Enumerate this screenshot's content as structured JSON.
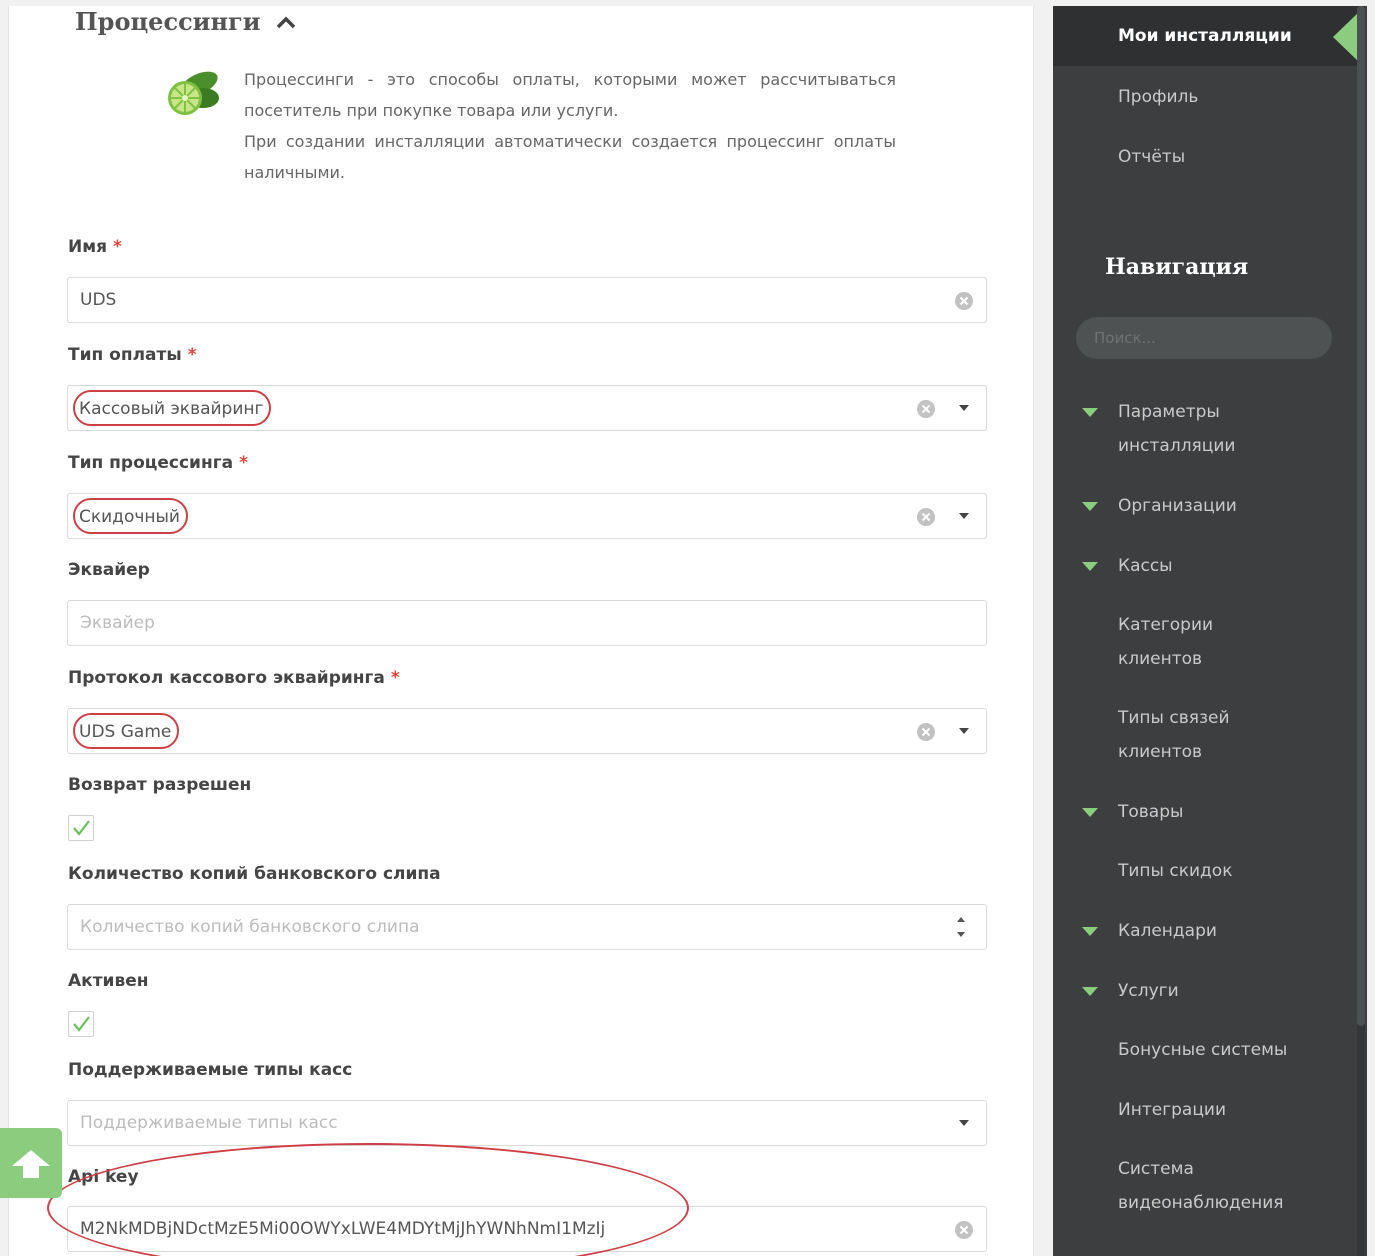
{
  "section": {
    "title": "Процессинги"
  },
  "intro": {
    "line1": "Процессинги - это способы оплаты, которыми может рассчитываться посетитель при покупке товара или услуги.",
    "line2": "При создании инсталляции автоматически создается процессинг оплаты наличными."
  },
  "form": {
    "name": {
      "label": "Имя",
      "required": "*",
      "value": "UDS"
    },
    "payment_type": {
      "label": "Тип оплаты",
      "required": "*",
      "value": "Кассовый эквайринг"
    },
    "processing_type": {
      "label": "Тип процессинга",
      "required": "*",
      "value": "Скидочный"
    },
    "acquirer": {
      "label": "Эквайер",
      "placeholder": "Эквайер"
    },
    "protocol": {
      "label": "Протокол кассового эквайринга",
      "required": "*",
      "value": "UDS Game"
    },
    "refund": {
      "label": "Возврат разрешен",
      "checked": true
    },
    "slip_copies": {
      "label": "Количество копий банковского слипа",
      "placeholder": "Количество копий банковского слипа"
    },
    "active": {
      "label": "Активен",
      "checked": true
    },
    "register_types": {
      "label": "Поддерживаемые типы касс",
      "placeholder": "Поддерживаемые типы касс"
    },
    "api_key": {
      "label": "Api key",
      "value": "M2NkMDBjNDctMzE5Mi00OWYxLWE4MDYtMjJhYWNhNmI1MzIj"
    }
  },
  "sidebar": {
    "top_items": [
      "Мои инсталляции",
      "Профиль",
      "Отчёты"
    ],
    "nav_title": "Навигация",
    "search_placeholder": "Поиск...",
    "nav_items": [
      {
        "label_1": "Параметры",
        "label_2": "инсталляции",
        "expandable": true
      },
      {
        "label_1": "Организации",
        "expandable": true
      },
      {
        "label_1": "Кассы",
        "expandable": true
      },
      {
        "label_1": "Категории",
        "label_2": "клиентов",
        "expandable": false
      },
      {
        "label_1": "Типы связей",
        "label_2": "клиентов",
        "expandable": false
      },
      {
        "label_1": "Товары",
        "expandable": true
      },
      {
        "label_1": "Типы скидок",
        "expandable": false
      },
      {
        "label_1": "Календари",
        "expandable": true
      },
      {
        "label_1": "Услуги",
        "expandable": true
      },
      {
        "label_1": "Бонусные системы",
        "expandable": false
      },
      {
        "label_1": "Интеграции",
        "expandable": false
      },
      {
        "label_1": "Система",
        "label_2": "видеонаблюдения",
        "expandable": false
      }
    ]
  },
  "colors": {
    "accent": "#8bcc7f",
    "highlight": "#cf3f45",
    "sidebar": "#3c3e3f"
  }
}
